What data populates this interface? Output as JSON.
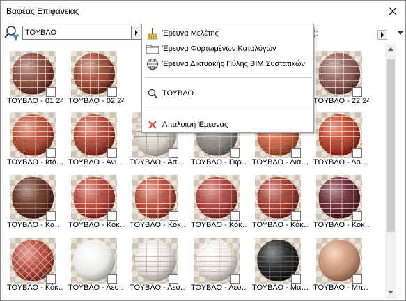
{
  "window": {
    "title": "Βαφέας Επιφάνειας"
  },
  "search": {
    "value": "ΤΟΥΒΛΟ",
    "right_label": "):"
  },
  "popup": {
    "items": [
      {
        "label": "Έρευνα Μελέτης",
        "icon": "broom-icon"
      },
      {
        "label": "Έρευνα Φορτωμένων Καταλόγων",
        "icon": "folder-icon"
      },
      {
        "label": "Έρευνα Δικτυακής Πύλης BIM Συστατικών",
        "icon": "globe-icon"
      }
    ],
    "recent_search": {
      "label": "ΤΟΥΒΛΟ",
      "icon": "magnifier-icon"
    },
    "clear": {
      "label": "Απαλοιφή Έρευνας",
      "icon": "x-icon"
    }
  },
  "tiles": [
    {
      "label": "ΤΟΥΒΛΟ - 01 24",
      "base": "#8a4a3c",
      "mortar": "#c9b9ae",
      "style": "brick-small"
    },
    {
      "label": "ΤΟΥΒΛΟ - 02 24",
      "base": "#9c4b36",
      "mortar": "#cbb8a4",
      "style": "brick-small"
    },
    {
      "label": "",
      "base": "",
      "mortar": "",
      "style": "hidden"
    },
    {
      "label": "",
      "base": "",
      "mortar": "",
      "style": "hidden"
    },
    {
      "label": "",
      "base": "",
      "mortar": "",
      "style": "hidden"
    },
    {
      "label": "ΤΟΥΒΛΟ - 22 24",
      "base": "#8e5d55",
      "mortar": "#c7c1ba",
      "style": "brick-small"
    },
    {
      "label": "ΤΟΥΒΛΟ - Ισό…",
      "base": "#b6523a",
      "mortar": "#d9c6b4",
      "style": "brick"
    },
    {
      "label": "ΤΟΥΒΛΟ - Ανι…",
      "base": "#b04a38",
      "mortar": "#d8c3b3",
      "style": "brick"
    },
    {
      "label": "ΤΟΥΒΛΟ - Ασ…",
      "base": "#d8d2c8",
      "mortar": "#a9a39a",
      "style": "brick"
    },
    {
      "label": "ΤΟΥΒΛΟ - Γκρ…",
      "base": "#8f8b86",
      "mortar": "#c6c2bc",
      "style": "brick"
    },
    {
      "label": "ΤΟΥΒΛΟ - Διά…",
      "base": "#c9664a",
      "mortar": "#e0b9a1",
      "style": "brick"
    },
    {
      "label": "ΤΟΥΒΛΟ - Δο…",
      "base": "#b8452f",
      "mortar": "#dcc0aa",
      "style": "brick"
    },
    {
      "label": "ΤΟΥΒΛΟ - Κα…",
      "base": "#6a3b2c",
      "mortar": "#9d7a66",
      "style": "brick"
    },
    {
      "label": "ΤΟΥΒΛΟ - Κόκ…",
      "base": "#b2483c",
      "mortar": "#d4b9ad",
      "style": "brick"
    },
    {
      "label": "ΤΟΥΒΛΟ - Κόκ…",
      "base": "#b8503f",
      "mortar": "#dcc5b8",
      "style": "brick"
    },
    {
      "label": "ΤΟΥΒΛΟ - Κόκ…",
      "base": "#ad4640",
      "mortar": "#d6bcb4",
      "style": "brick"
    },
    {
      "label": "ΤΟΥΒΛΟ - Κόκ…",
      "base": "#a13f33",
      "mortar": "#cfb2a6",
      "style": "brick"
    },
    {
      "label": "ΤΟΥΒΛΟ - Κόκ…",
      "base": "#6e2e38",
      "mortar": "#b8a8ad",
      "style": "brick"
    },
    {
      "label": "ΤΟΥΒΛΟ - Κόκ…",
      "base": "#b24a3d",
      "mortar": "#d6b8a8",
      "style": "herringbone"
    },
    {
      "label": "ΤΟΥΒΛΟ - Λευ…",
      "base": "#efedea",
      "mortar": "#c9c6c1",
      "style": "plain"
    },
    {
      "label": "ΤΟΥΒΛΟ - Λευ…",
      "base": "#e8e4df",
      "mortar": "#bdb8b1",
      "style": "brick"
    },
    {
      "label": "ΤΟΥΒΛΟ - Λευ…",
      "base": "#ece8e3",
      "mortar": "#c4bfb8",
      "style": "brick"
    },
    {
      "label": "ΤΟΥΒΛΟ - Μα…",
      "base": "#2d2b2a",
      "mortar": "#5a5755",
      "style": "brick"
    },
    {
      "label": "ΤΟΥΒΛΟ - Μπ…",
      "base": "#c8967a",
      "mortar": "#dbc1ae",
      "style": "plain"
    }
  ]
}
